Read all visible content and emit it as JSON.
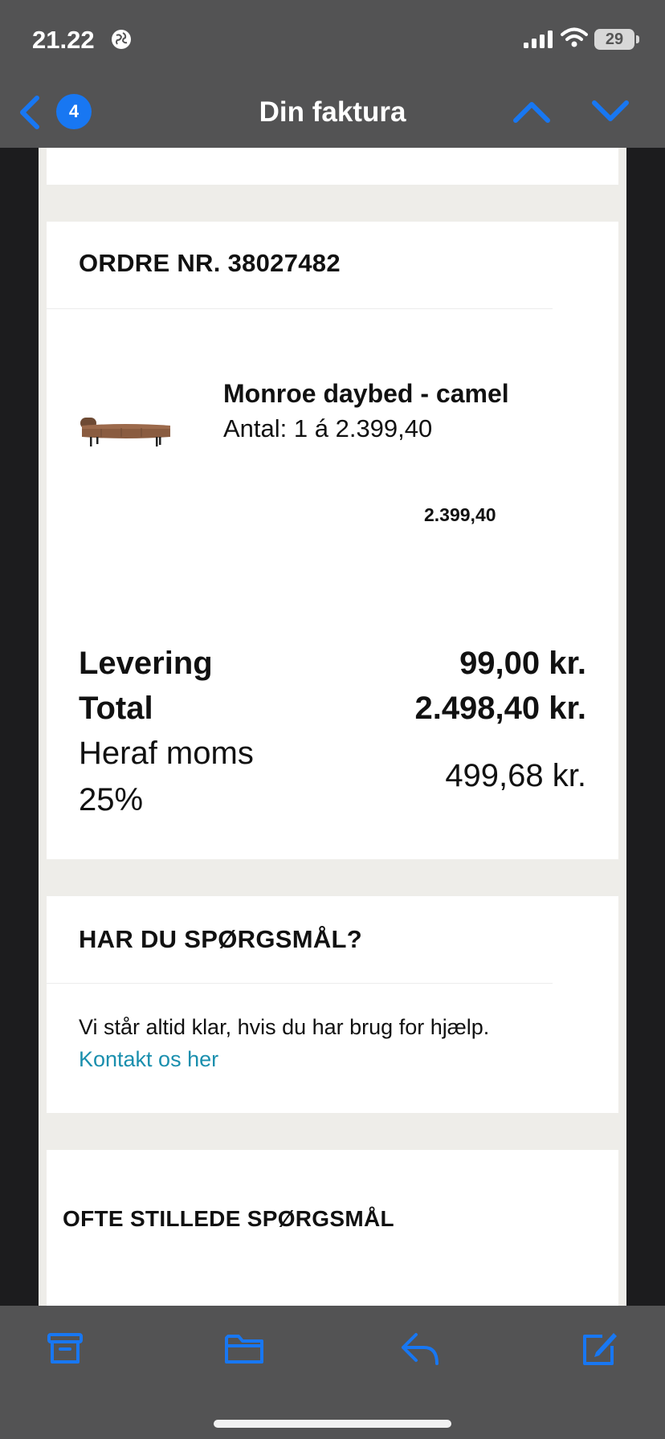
{
  "status_bar": {
    "time": "21.22",
    "battery": "29"
  },
  "nav": {
    "title": "Din faktura",
    "back_badge": "4"
  },
  "order": {
    "heading": "ORDRE NR. 38027482",
    "item": {
      "name": "Monroe daybed - camel",
      "quantity_line": "Antal: 1 á 2.399,40",
      "price": "2.399,40"
    },
    "summary": {
      "delivery_label": "Levering",
      "delivery_value": "99,00 kr.",
      "total_label": "Total",
      "total_value": "2.498,40 kr.",
      "vat_label_line1": "Heraf moms",
      "vat_label_line2": "25%",
      "vat_value": "499,68 kr."
    }
  },
  "help": {
    "heading": "HAR DU SPØRGSMÅL?",
    "text": "Vi står altid klar, hvis du har brug for hjælp.",
    "link": "Kontakt os her"
  },
  "faq": {
    "heading": "OFTE STILLEDE SPØRGSMÅL"
  },
  "toolbar": {
    "icons": [
      "archive-icon",
      "folder-icon",
      "reply-icon",
      "compose-icon"
    ]
  },
  "colors": {
    "accent": "#1877f2",
    "link": "#1a8fae",
    "chrome": "#535354",
    "email_bg": "#eeede9"
  }
}
